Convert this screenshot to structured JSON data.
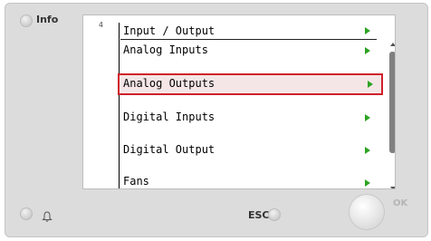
{
  "device": {
    "info_label": "Info",
    "esc_label": "ESC",
    "ok_label": "OK"
  },
  "screen": {
    "page_number": "4",
    "title": "Input / Output",
    "menu_items": [
      {
        "label": "Analog Inputs",
        "selected": false
      },
      {
        "label": "Analog Outputs",
        "selected": true
      },
      {
        "label": "Digital Inputs",
        "selected": false
      },
      {
        "label": "Digital Output",
        "selected": false
      },
      {
        "label": "Fans",
        "selected": false
      }
    ]
  },
  "colors": {
    "arrow": "#2ea323",
    "selection_border": "#d0202b",
    "selection_fill": "#f4e6e6"
  },
  "icons": [
    "bell-icon",
    "play-arrow-icon",
    "scroll-up-icon",
    "scroll-down-icon"
  ]
}
